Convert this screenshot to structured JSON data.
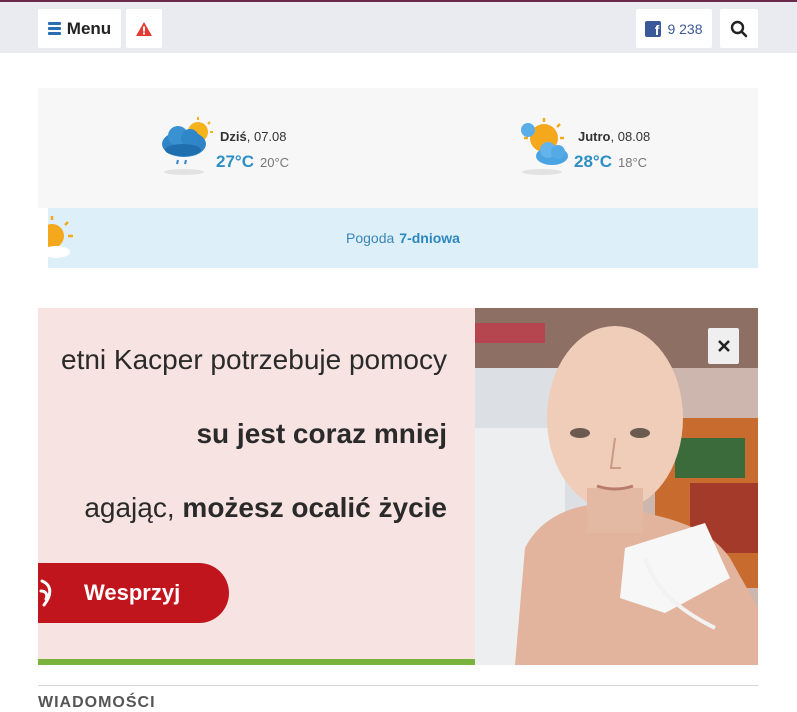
{
  "header": {
    "menu_label": "Menu",
    "facebook_count": "9 238"
  },
  "weather": {
    "today": {
      "label": "Dziś",
      "date": ", 07.08",
      "high": "27°C",
      "low": "20°C",
      "icon": "rain-cloud-sun-icon"
    },
    "tomorrow": {
      "label": "Jutro",
      "date": ", 08.08",
      "high": "28°C",
      "low": "18°C",
      "icon": "sun-cloud-icon"
    },
    "forecast_prefix": "Pogoda",
    "forecast_link": "7-dniowa"
  },
  "ad": {
    "line1": "etni Kacper potrzebuje pomocy",
    "line2": "su jest coraz mniej",
    "line3_prefix": "agając, ",
    "line3_bold": "możesz ocalić życie",
    "donate_label": "Wesprzyj",
    "close_label": "×"
  },
  "section": {
    "title": "WIADOMOŚCI"
  },
  "colors": {
    "accent": "#2d8fc4",
    "donate": "#c1151d",
    "facebook": "#3b5998",
    "alert": "#e53935"
  }
}
